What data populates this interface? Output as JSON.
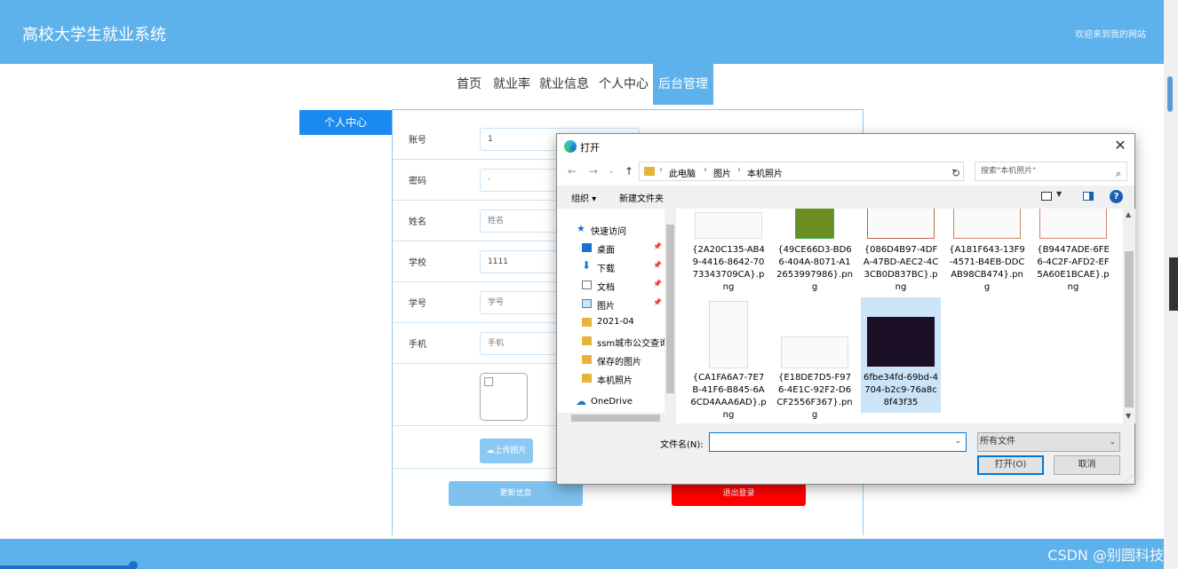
{
  "header": {
    "title": "高校大学生就业系统",
    "welcome": "欢迎来到我的网站"
  },
  "nav": {
    "items": [
      {
        "label": "首页"
      },
      {
        "label": "就业率"
      },
      {
        "label": "就业信息"
      },
      {
        "label": "个人中心"
      },
      {
        "label": "后台管理"
      }
    ]
  },
  "sidebar": {
    "tab_label": "个人中心"
  },
  "form": {
    "fields": [
      {
        "label": "账号",
        "value": "1"
      },
      {
        "label": "密码",
        "value": "·"
      },
      {
        "label": "姓名",
        "value": "姓名"
      },
      {
        "label": "学校",
        "value": "1111"
      },
      {
        "label": "学号",
        "value": "学号"
      },
      {
        "label": "手机",
        "value": "手机"
      }
    ],
    "upload_label": "上传图片",
    "update_label": "更新信息",
    "logout_label": "退出登录"
  },
  "watermark": "CSDN @别圆科技",
  "dialog": {
    "title": "打开",
    "breadcrumb": [
      "此电脑",
      "图片",
      "本机照片"
    ],
    "search_placeholder": "搜索\"本机照片\"",
    "toolbar": {
      "organize": "组织 ▾",
      "new_folder": "新建文件夹"
    },
    "nav_pane": [
      {
        "label": "快速访问",
        "icon": "star-icon",
        "pinned": false
      },
      {
        "label": "桌面",
        "icon": "desktop-icon",
        "pinned": true
      },
      {
        "label": "下载",
        "icon": "download-icon",
        "pinned": true
      },
      {
        "label": "文档",
        "icon": "document-icon",
        "pinned": true
      },
      {
        "label": "图片",
        "icon": "pictures-icon",
        "pinned": true
      },
      {
        "label": "2021-04",
        "icon": "folder-icon",
        "pinned": false
      },
      {
        "label": "ssm城市公交查询",
        "icon": "folder-icon",
        "pinned": false
      },
      {
        "label": "保存的图片",
        "icon": "folder-icon",
        "pinned": false
      },
      {
        "label": "本机照片",
        "icon": "folder-icon",
        "pinned": false
      },
      {
        "label": "OneDrive",
        "icon": "cloud-icon",
        "pinned": false
      }
    ],
    "files": [
      {
        "name": "{2A20C135-AB49-4416-8642-7073343709CA}.png",
        "selected": false
      },
      {
        "name": "{49CE66D3-BD66-404A-8071-A12653997986}.png",
        "selected": false
      },
      {
        "name": "{086D4B97-4DFA-47BD-AEC2-4C3CB0D837BC}.png",
        "selected": false
      },
      {
        "name": "{A181F643-13F9-4571-B4EB-DDCAB98CB474}.png",
        "selected": false
      },
      {
        "name": "{B9447ADE-6FE6-4C2F-AFD2-EF5A60E1BCAE}.png",
        "selected": false
      },
      {
        "name": "{CA1FA6A7-7E7B-41F6-B845-6A6CD4AAA6AD}.png",
        "selected": false
      },
      {
        "name": "{E18DE7D5-F976-4E1C-92F2-D6CF2556F367}.png",
        "selected": false
      },
      {
        "name": "6fbe34fd-69bd-4704-b2c9-76a8c8f43f35",
        "selected": true
      }
    ],
    "filename_label": "文件名(N):",
    "filename_value": "",
    "filetype_value": "所有文件",
    "open_label": "打开(O)",
    "cancel_label": "取消"
  },
  "colors": {
    "accent": "#5eb2ec",
    "nav_active": "#5eb2ec",
    "logout": "#ff0000",
    "update": "#7ec0ee"
  }
}
